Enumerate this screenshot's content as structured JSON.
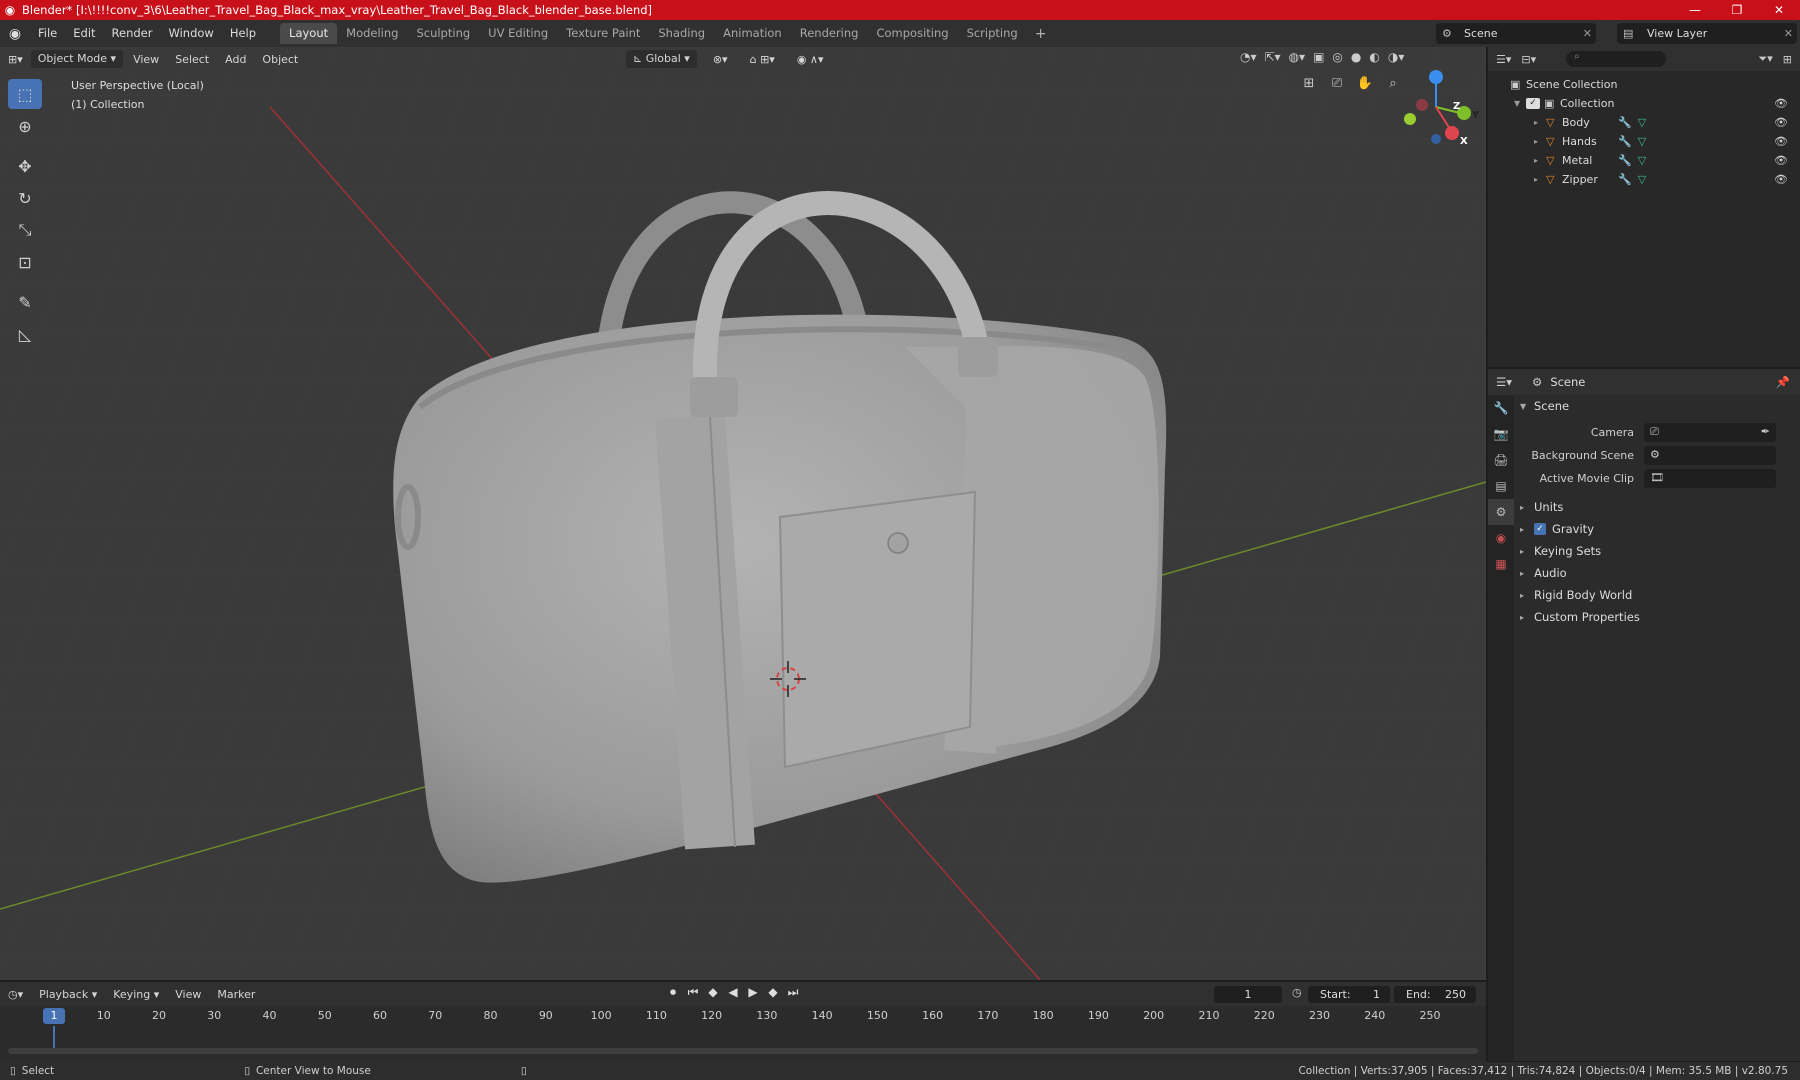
{
  "window": {
    "title": "Blender* [I:\\!!!!conv_3\\6\\Leather_Travel_Bag_Black_max_vray\\Leather_Travel_Bag_Black_blender_base.blend]",
    "controls": [
      "—",
      "❐",
      "✕"
    ]
  },
  "menu": [
    "File",
    "Edit",
    "Render",
    "Window",
    "Help"
  ],
  "workspaces": [
    "Layout",
    "Modeling",
    "Sculpting",
    "UV Editing",
    "Texture Paint",
    "Shading",
    "Animation",
    "Rendering",
    "Compositing",
    "Scripting"
  ],
  "workspace_add": "+",
  "scene_name": "Scene",
  "view_layer": "View Layer",
  "viewport": {
    "mode": "Object Mode",
    "menus": [
      "View",
      "Select",
      "Add",
      "Object"
    ],
    "transform": "Global",
    "info_line1": "User Perspective (Local)",
    "info_line2": "(1) Collection",
    "gizmo": {
      "x": "X",
      "y": "Y",
      "z": "Z"
    }
  },
  "outliner": {
    "root": "Scene Collection",
    "collection": "Collection",
    "objects": [
      "Body",
      "Hands",
      "Metal",
      "Zipper"
    ]
  },
  "properties": {
    "header": "Scene",
    "panel": "Scene",
    "camera_label": "Camera",
    "background_scene_label": "Background Scene",
    "active_movie_clip_label": "Active Movie Clip",
    "sections": [
      "Units",
      "Gravity",
      "Keying Sets",
      "Audio",
      "Rigid Body World",
      "Custom Properties"
    ]
  },
  "timeline": {
    "menus": [
      "Playback",
      "Keying",
      "View",
      "Marker"
    ],
    "current_frame": "1",
    "start_label": "Start:",
    "start": "1",
    "end_label": "End:",
    "end": "250",
    "ticks": [
      "1",
      "10",
      "20",
      "30",
      "40",
      "50",
      "60",
      "70",
      "80",
      "90",
      "100",
      "110",
      "120",
      "130",
      "140",
      "150",
      "160",
      "170",
      "180",
      "190",
      "200",
      "210",
      "220",
      "230",
      "240",
      "250"
    ]
  },
  "status": {
    "left_action": "Select",
    "middle_action": "Center View to Mouse",
    "stats": "Collection | Verts:37,905 | Faces:37,412 | Tris:74,824 | Objects:0/4 | Mem: 35.5 MB | v2.80.75"
  },
  "colors": {
    "accent": "#4772b3",
    "titlebar": "#c8101b",
    "object_icon": "#e0862e",
    "x_axis": "#e0454f",
    "y_axis": "#7fbf2a",
    "z_axis": "#3a8ef0"
  }
}
